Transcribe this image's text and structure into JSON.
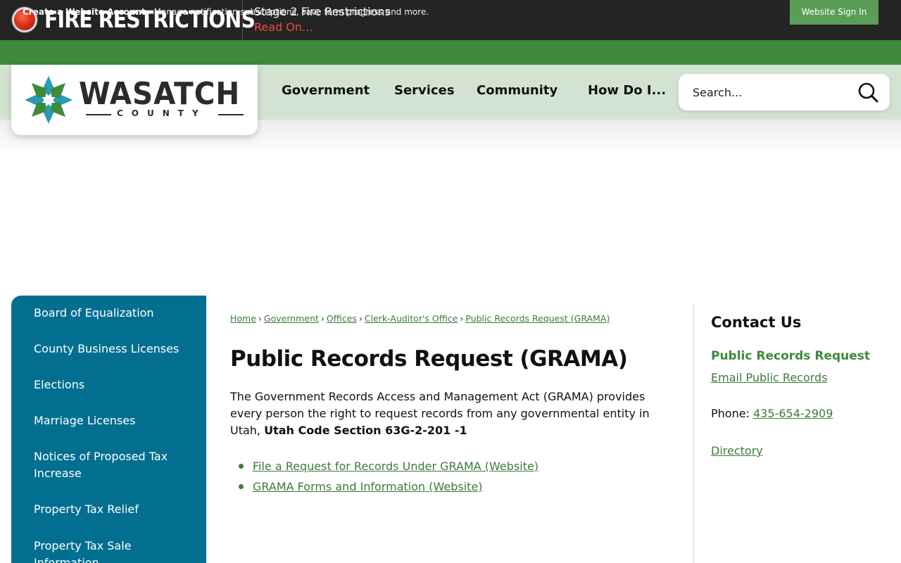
{
  "alert": {
    "title": "FIRE RESTRICTIONS",
    "message": "Stage 2 Fire Restrictions",
    "link": "Read On...",
    "dot_color": "#e0301a"
  },
  "account_bar": {
    "create_label": "Create a Website Account",
    "description": " - Manage notification subscriptions, save form progress and more.",
    "signin_label": "Website Sign In"
  },
  "logo": {
    "name": "WASATCH",
    "subtitle": "COUNTY",
    "colors": [
      "#2a9bb8",
      "#3d8a3b",
      "#1f6f7f"
    ]
  },
  "nav": {
    "items": [
      {
        "label": "Government"
      },
      {
        "label": "Services"
      },
      {
        "label": "Community"
      },
      {
        "label": "How Do I..."
      }
    ]
  },
  "search": {
    "placeholder": "Search...",
    "icon": "search-icon"
  },
  "sidebar": {
    "items": [
      {
        "label": "Board of Equalization"
      },
      {
        "label": "County Business Licenses"
      },
      {
        "label": "Elections"
      },
      {
        "label": "Marriage Licenses"
      },
      {
        "label": "Notices of Proposed Tax Increase"
      },
      {
        "label": "Property Tax Relief"
      },
      {
        "label": "Property Tax Sale Information"
      }
    ],
    "color": "#036f90"
  },
  "breadcrumb": {
    "items": [
      "Home",
      "Government",
      "Offices",
      "Clerk-Auditor's Office",
      "Public Records Request (GRAMA)"
    ],
    "separator": "›"
  },
  "main": {
    "title": "Public Records Request (GRAMA)",
    "intro_text": "The Government Records Access and Management Act (GRAMA) provides every person the right to request records from any governmental entity in Utah, ",
    "intro_bold": "Utah Code Section 63G-2-201 -1",
    "links": [
      {
        "label": "File a Request for Records Under GRAMA (Website)"
      },
      {
        "label": "GRAMA Forms and Information (Website)"
      }
    ]
  },
  "contact": {
    "title": "Contact Us",
    "subtitle": "Public Records Request",
    "email_link": "Email Public Records",
    "phone_label": "Phone: ",
    "phone": "435-654-2909",
    "directory_link": "Directory"
  }
}
